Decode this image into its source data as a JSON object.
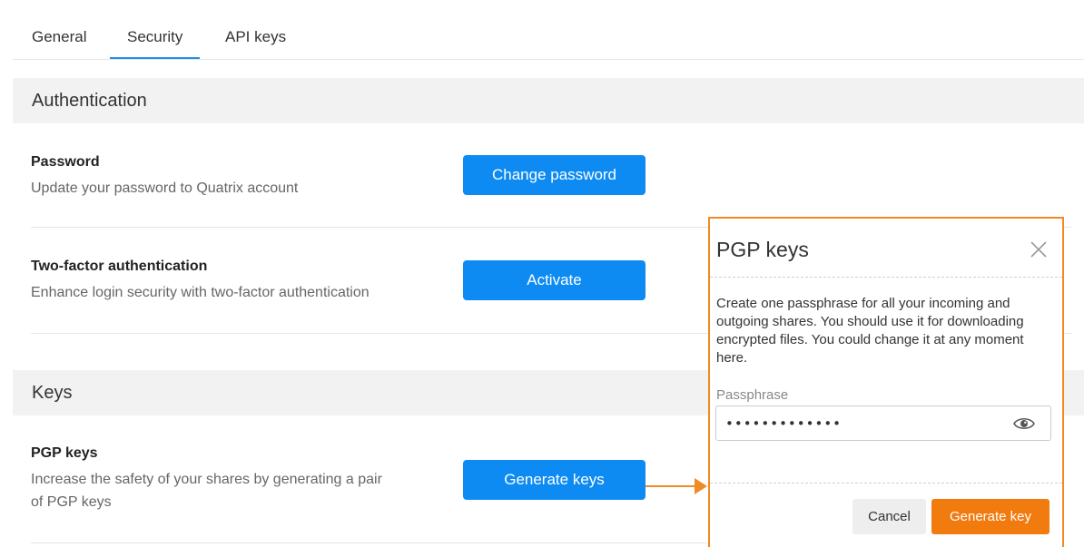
{
  "tabs": [
    {
      "label": "General",
      "active": false
    },
    {
      "label": "Security",
      "active": true
    },
    {
      "label": "API keys",
      "active": false
    }
  ],
  "sections": {
    "authentication": {
      "title": "Authentication"
    },
    "keys": {
      "title": "Keys"
    }
  },
  "rows": {
    "password": {
      "title": "Password",
      "description": "Update your password to Quatrix account",
      "button": "Change password"
    },
    "two_factor": {
      "title": "Two-factor authentication",
      "description": "Enhance login security with two-factor authentication",
      "button": "Activate"
    },
    "pgp": {
      "title": "PGP keys",
      "description_line1": "Increase the safety of your shares by generating a pair",
      "description_line2": "of PGP keys",
      "button": "Generate keys"
    }
  },
  "modal": {
    "title": "PGP keys",
    "close_icon": "close-icon",
    "text": "Create one passphrase for all your incoming and outgoing shares. You should use it for downloading encrypted files. You could change it at any moment here.",
    "passphrase_label": "Passphrase",
    "passphrase_value": "•••••••••••••",
    "eye_icon": "eye-icon",
    "cancel_label": "Cancel",
    "generate_label": "Generate key"
  },
  "colors": {
    "accent_blue": "#0d8bf2",
    "accent_orange": "#f27b10",
    "highlight_border": "#f08a24"
  }
}
